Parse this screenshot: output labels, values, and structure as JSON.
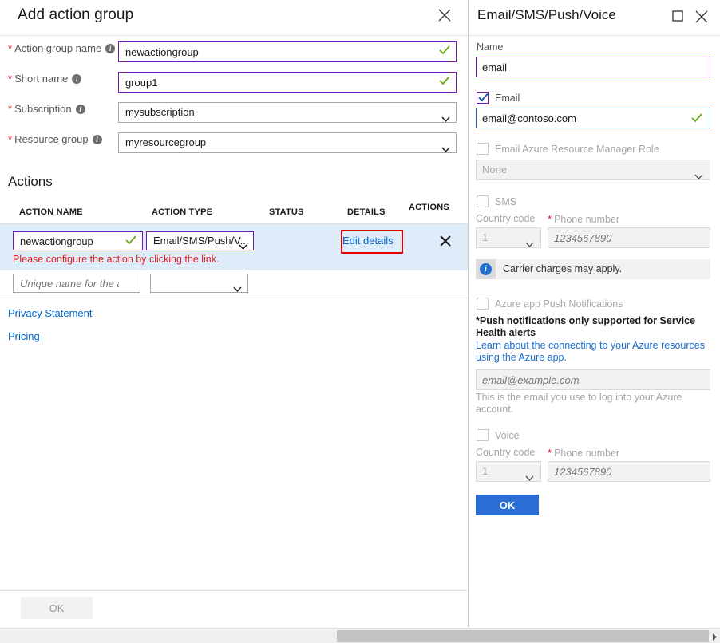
{
  "left_blade": {
    "title": "Add action group",
    "close_icon": "close-icon",
    "fields": [
      {
        "label": "Action group name",
        "required": true,
        "info": true,
        "type": "text",
        "value": "newactiongroup",
        "valid": true
      },
      {
        "label": "Short name",
        "required": true,
        "info": true,
        "type": "text",
        "value": "group1",
        "valid": true
      },
      {
        "label": "Subscription",
        "required": true,
        "info": true,
        "type": "select",
        "value": "mysubscription"
      },
      {
        "label": "Resource group",
        "required": true,
        "info": true,
        "type": "select",
        "value": "myresourcegroup"
      }
    ],
    "actions": {
      "heading": "Actions",
      "columns": [
        "ACTION NAME",
        "ACTION TYPE",
        "STATUS",
        "DETAILS",
        "ACTIONS"
      ],
      "rows": [
        {
          "name": "newactiongroup",
          "name_valid": true,
          "type": "Email/SMS/Push/V...",
          "status": "",
          "details_link": "Edit details",
          "details_highlighted": true,
          "error": "Please configure the action by clicking the link.",
          "remove_icon": "close-icon"
        },
        {
          "name": "",
          "name_placeholder": "Unique name for the act...",
          "type": "",
          "status": "",
          "details_link": "",
          "error": ""
        }
      ]
    },
    "links": [
      {
        "label": "Privacy Statement"
      },
      {
        "label": "Pricing"
      }
    ],
    "ok_label": "OK",
    "ok_disabled": true
  },
  "right_blade": {
    "title": "Email/SMS/Push/Voice",
    "maximize_icon": "maximize-icon",
    "close_icon": "close-icon",
    "name_label": "Name",
    "name_value": "email",
    "email": {
      "checkbox_label": "Email",
      "checked": true,
      "value": "email@contoso.com",
      "valid": true
    },
    "arm_role": {
      "checkbox_label": "Email Azure Resource Manager Role",
      "checked": false,
      "select_value": "None"
    },
    "sms": {
      "checkbox_label": "SMS",
      "checked": false,
      "country_code_label": "Country code",
      "country_code_value": "1",
      "phone_label": "Phone number",
      "phone_required": true,
      "phone_placeholder": "1234567890"
    },
    "info_bar": {
      "icon": "info-icon",
      "text": "Carrier charges may apply."
    },
    "push": {
      "checkbox_label": "Azure app Push Notifications",
      "checked": false,
      "note": "*Push notifications only supported for Service Health alerts",
      "link": "Learn about the connecting to your Azure resources using the Azure app.",
      "email_placeholder": "email@example.com",
      "help": "This is the email you use to log into your Azure account."
    },
    "voice": {
      "checkbox_label": "Voice",
      "checked": false,
      "country_code_label": "Country code",
      "country_code_value": "1",
      "phone_label": "Phone number",
      "phone_required": true,
      "phone_placeholder": "1234567890"
    },
    "ok_label": "OK"
  },
  "scrollbar": {
    "orientation": "horizontal",
    "right_arrow_icon": "chevron-right-icon"
  },
  "colors": {
    "accent_blue": "#2b6fd6",
    "link_blue": "#0066cc",
    "valid_purple": "#7719aa",
    "error_red": "#e02020",
    "highlight_red": "#e00000",
    "row_selected_bg": "#deecf9",
    "required_asterisk": "#e81123",
    "check_green": "#6aa80f"
  }
}
